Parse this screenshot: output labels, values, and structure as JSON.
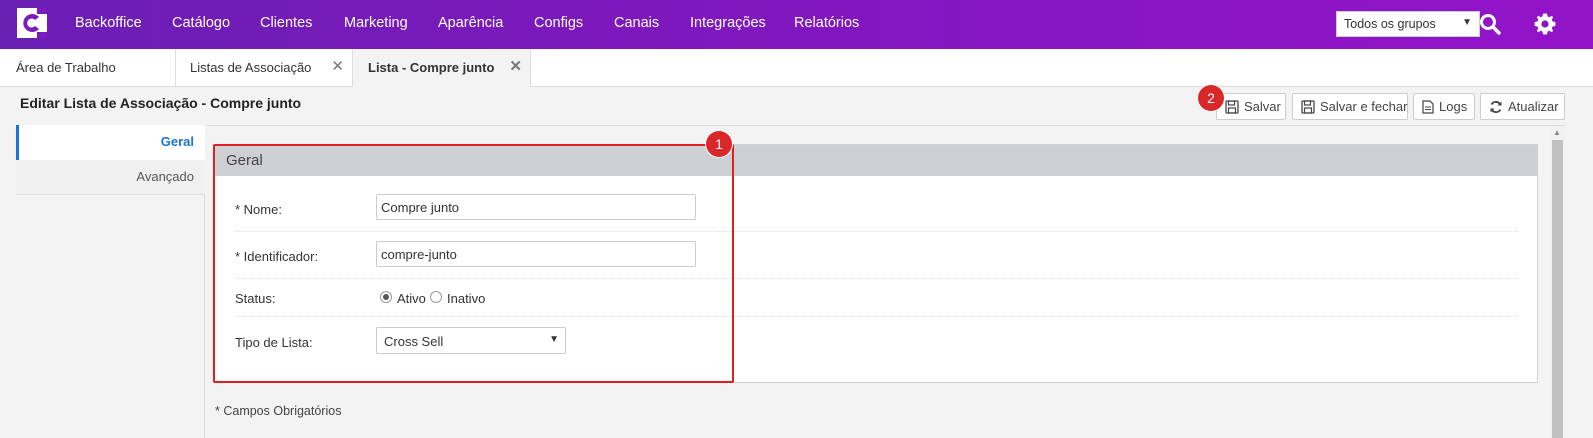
{
  "nav": {
    "items": [
      "Backoffice",
      "Catálogo",
      "Clientes",
      "Marketing",
      "Aparência",
      "Configs",
      "Canais",
      "Integrações",
      "Relatórios"
    ],
    "group_select": "Todos os grupos",
    "search_icon": "search-icon",
    "settings_icon": "gear-icon"
  },
  "tabs": [
    {
      "label": "Área de Trabalho"
    },
    {
      "label": "Listas de Associação"
    },
    {
      "label": "Lista - Compre junto"
    }
  ],
  "header": {
    "title": "Editar Lista de Associação - Compre junto",
    "buttons": {
      "save": "Salvar",
      "save_close": "Salvar e fechar",
      "logs": "Logs",
      "refresh": "Atualizar"
    }
  },
  "subtabs": [
    "Geral",
    "Avançado"
  ],
  "form": {
    "section_title": "Geral",
    "nome_label": "* Nome:",
    "nome_value": "Compre junto",
    "ident_label": "* Identificador:",
    "ident_value": "compre-junto",
    "status_label": "Status:",
    "status_options": [
      "Ativo",
      "Inativo"
    ],
    "status_selected": "Ativo",
    "tipo_label": "Tipo de Lista:",
    "tipo_value": "Cross Sell"
  },
  "footnote": "* Campos Obrigatórios",
  "annotations": {
    "badge1": "1",
    "badge2": "2",
    "color": "#d9282a"
  }
}
